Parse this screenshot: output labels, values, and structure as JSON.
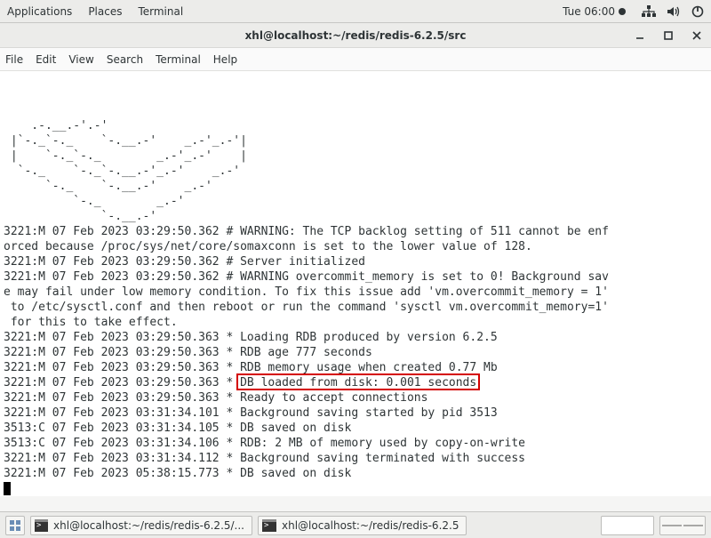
{
  "panel": {
    "applications": "Applications",
    "places": "Places",
    "terminal": "Terminal",
    "clock": "Tue 06:00"
  },
  "window": {
    "title": "xhl@localhost:~/redis/redis-6.2.5/src"
  },
  "menubar": {
    "file": "File",
    "edit": "Edit",
    "view": "View",
    "search": "Search",
    "terminal": "Terminal",
    "help": "Help"
  },
  "terminal_lines": [
    "    .-.__.-'.-'",
    " |`-._`-._    `-.__.-'    _.-'_.-'|",
    " |    `-._`-._        _.-'_.-'    |",
    "  `-._    `-._`-.__.-'_.-'    _.-'",
    "      `-._    `-.__.-'    _.-'",
    "          `-._        _.-'",
    "              `-.__.-'",
    "",
    "3221:M 07 Feb 2023 03:29:50.362 # WARNING: The TCP backlog setting of 511 cannot be enf",
    "orced because /proc/sys/net/core/somaxconn is set to the lower value of 128.",
    "3221:M 07 Feb 2023 03:29:50.362 # Server initialized",
    "3221:M 07 Feb 2023 03:29:50.362 # WARNING overcommit_memory is set to 0! Background sav",
    "e may fail under low memory condition. To fix this issue add 'vm.overcommit_memory = 1'",
    " to /etc/sysctl.conf and then reboot or run the command 'sysctl vm.overcommit_memory=1'",
    " for this to take effect.",
    "3221:M 07 Feb 2023 03:29:50.363 * Loading RDB produced by version 6.2.5",
    "3221:M 07 Feb 2023 03:29:50.363 * RDB age 777 seconds",
    "3221:M 07 Feb 2023 03:29:50.363 * RDB memory usage when created 0.77 Mb",
    "3221:M 07 Feb 2023 03:29:50.363 * DB loaded from disk: 0.001 seconds",
    "3221:M 07 Feb 2023 03:29:50.363 * Ready to accept connections",
    "3221:M 07 Feb 2023 03:31:34.101 * Background saving started by pid 3513",
    "3513:C 07 Feb 2023 03:31:34.105 * DB saved on disk",
    "3513:C 07 Feb 2023 03:31:34.106 * RDB: 2 MB of memory used by copy-on-write",
    "3221:M 07 Feb 2023 03:31:34.112 * Background saving terminated with success",
    "3221:M 07 Feb 2023 05:38:15.773 * DB saved on disk"
  ],
  "highlight_line_index": 18,
  "taskbar": {
    "task1": "xhl@localhost:~/redis/redis-6.2.5/...",
    "task2": "xhl@localhost:~/redis/redis-6.2.5"
  }
}
